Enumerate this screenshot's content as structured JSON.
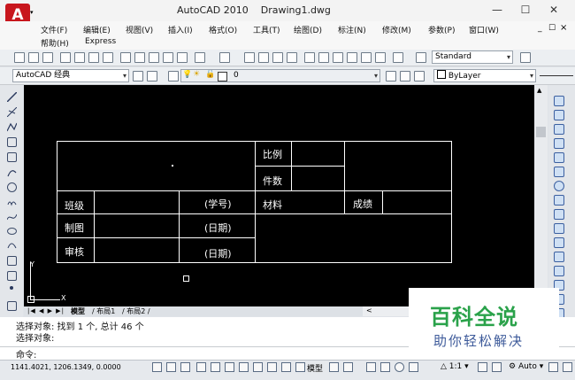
{
  "window": {
    "app_title": "AutoCAD 2010",
    "doc_title": "Drawing1.dwg",
    "app_logo": "A",
    "controls": {
      "minimize": "—",
      "maximize": "☐",
      "close": "✕",
      "doc_minimize": "_",
      "doc_restore": "☐",
      "doc_close": "×"
    }
  },
  "menu": {
    "row1": [
      "文件(F)",
      "编辑(E)",
      "视图(V)",
      "插入(I)",
      "格式(O)",
      "工具(T)",
      "绘图(D)",
      "标注(N)",
      "修改(M)",
      "参数(P)",
      "窗口(W)"
    ],
    "row2": [
      "帮助(H)",
      "Express"
    ]
  },
  "toolbar1": {
    "text_style": "Standard"
  },
  "toolbar2": {
    "workspace": "AutoCAD 经典",
    "layer": "0",
    "color": "ByLayer"
  },
  "drawing": {
    "title_block": {
      "scale_label": "比例",
      "qty_label": "件数",
      "class_label": "班级",
      "student_id": "(学号)",
      "material_label": "材料",
      "score_label": "成绩",
      "drafted_label": "制图",
      "date1": "(日期)",
      "reviewed_label": "审核",
      "date2": "(日期)"
    },
    "ucs": {
      "y": "Y",
      "x": "X"
    }
  },
  "layout_tabs": [
    "模型",
    "布局1",
    "布局2"
  ],
  "command": {
    "history": [
      "选择对象: 找到 1 个, 总计 46 个",
      "选择对象:"
    ],
    "prompt": "命令:"
  },
  "status": {
    "coordinates": "1141.4021, 1206.1349, 0.0000",
    "model_label": "模型",
    "scale": "1:1",
    "auto": "Auto"
  },
  "watermark": {
    "title": "百科全说",
    "subtitle": "助你轻松解决"
  },
  "colors": {
    "canvas": "#000000",
    "logo": "#c8161d",
    "watermark_green": "#2aa24a",
    "watermark_blue": "#3d5a9a"
  }
}
